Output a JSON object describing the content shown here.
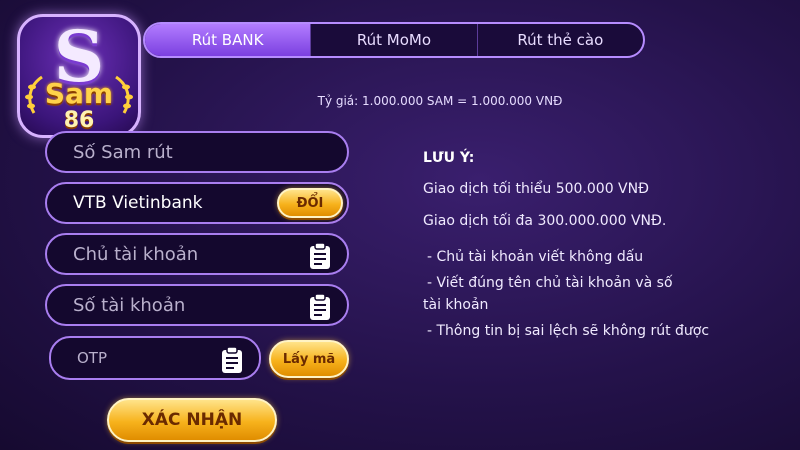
{
  "logo": {
    "letter": "S",
    "brand": "Sam",
    "number": "86"
  },
  "tabs": [
    {
      "label": "Rút BANK",
      "active": true
    },
    {
      "label": "Rút MoMo",
      "active": false
    },
    {
      "label": "Rút thẻ cào",
      "active": false
    }
  ],
  "rate": "Tỷ giá: 1.000.000 SAM = 1.000.000 VNĐ",
  "form": {
    "amount_placeholder": "Số Sam rút",
    "bank_value": "VTB Vietinbank",
    "change_label": "ĐỔI",
    "holder_placeholder": "Chủ tài khoản",
    "account_placeholder": "Số tài khoản",
    "otp_placeholder": "OTP",
    "get_code_label": "Lấy mã",
    "confirm_label": "XÁC NHẬN"
  },
  "notes": {
    "title": "LƯU Ý:",
    "min": "Giao dịch tối thiểu 500.000 VNĐ",
    "max": "Giao dịch tối đa 300.000.000 VNĐ.",
    "bullets": [
      "- Chủ tài khoản viết không dấu",
      "- Viết đúng tên chủ tài khoản và số",
      "tài khoản",
      "- Thông tin bị sai lệch sẽ không rút được"
    ]
  },
  "colors": {
    "accent": "#a97ef0",
    "gold": "#f7b21c",
    "bg": "#24124a"
  }
}
